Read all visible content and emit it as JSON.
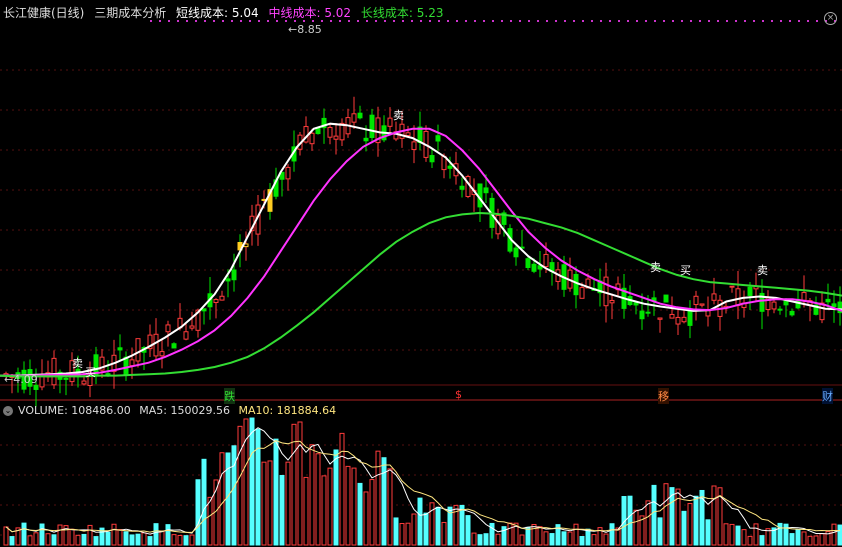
{
  "header": {
    "stock_name": "长江健康(日线)",
    "indicator_name": "三期成本分析",
    "short_label": "短线成本:",
    "short_value": "5.04",
    "mid_label": "中线成本:",
    "mid_value": "5.02",
    "long_label": "长线成本:",
    "long_value": "5.23"
  },
  "volume_header": {
    "label": "VOLUME: 108486.00",
    "ma5_label": "MA5: 150029.56",
    "ma10_label": "MA10: 181884.64"
  },
  "annotations": {
    "high": "←8.85",
    "low": "←4.09",
    "signals": [
      "卖",
      "买",
      "卖",
      "卖",
      "买",
      "卖"
    ],
    "events": [
      "跌",
      "$",
      "移",
      "财"
    ]
  },
  "colors": {
    "up": "#ff3b3b",
    "down": "#00e600",
    "short_line": "#ffffff",
    "mid_line": "#ff33ff",
    "long_line": "#33dd33",
    "volume_up": "#ff3b3b",
    "volume_down": "#55ffff",
    "ma10": "#ffe680"
  },
  "chart_data": {
    "type": "candlestick",
    "price_high": 8.85,
    "price_low": 4.09,
    "series": [
      {
        "name": "短线成本",
        "last": 5.04,
        "shape": [
          4.12,
          4.12,
          4.13,
          4.14,
          4.15,
          4.17,
          4.22,
          4.3,
          4.4,
          4.52,
          4.65,
          4.8,
          5.0,
          5.25,
          5.6,
          6.05,
          6.5,
          6.95,
          7.3,
          7.55,
          7.62,
          7.6,
          7.55,
          7.5,
          7.48,
          7.42,
          7.3,
          7.15,
          6.9,
          6.6,
          6.3,
          6.0,
          5.78,
          5.62,
          5.5,
          5.4,
          5.32,
          5.25,
          5.18,
          5.12,
          5.08,
          5.05,
          5.02,
          5.03,
          5.15,
          5.2,
          5.22,
          5.2,
          5.15,
          5.1,
          5.05,
          5.04
        ]
      },
      {
        "name": "中线成本",
        "last": 5.02,
        "shape": [
          4.12,
          4.12,
          4.12,
          4.13,
          4.13,
          4.14,
          4.16,
          4.2,
          4.25,
          4.3,
          4.38,
          4.48,
          4.6,
          4.75,
          4.95,
          5.2,
          5.5,
          5.85,
          6.2,
          6.55,
          6.85,
          7.1,
          7.3,
          7.42,
          7.5,
          7.55,
          7.55,
          7.45,
          7.25,
          7.0,
          6.7,
          6.4,
          6.12,
          5.9,
          5.72,
          5.58,
          5.46,
          5.36,
          5.28,
          5.2,
          5.12,
          5.07,
          5.04,
          5.03,
          5.06,
          5.12,
          5.16,
          5.18,
          5.18,
          5.15,
          5.1,
          5.02
        ]
      },
      {
        "name": "长线成本",
        "last": 5.23,
        "shape": [
          4.12,
          4.11,
          4.11,
          4.11,
          4.11,
          4.11,
          4.12,
          4.12,
          4.13,
          4.14,
          4.15,
          4.17,
          4.2,
          4.24,
          4.3,
          4.38,
          4.5,
          4.65,
          4.82,
          5.0,
          5.2,
          5.4,
          5.6,
          5.8,
          5.98,
          6.12,
          6.24,
          6.32,
          6.36,
          6.38,
          6.37,
          6.34,
          6.3,
          6.24,
          6.18,
          6.1,
          6.0,
          5.9,
          5.8,
          5.7,
          5.6,
          5.52,
          5.46,
          5.42,
          5.4,
          5.38,
          5.36,
          5.34,
          5.32,
          5.3,
          5.27,
          5.23
        ]
      }
    ],
    "volume": {
      "last": 108486.0,
      "ma5": 150029.56,
      "ma10": 181884.64
    }
  }
}
